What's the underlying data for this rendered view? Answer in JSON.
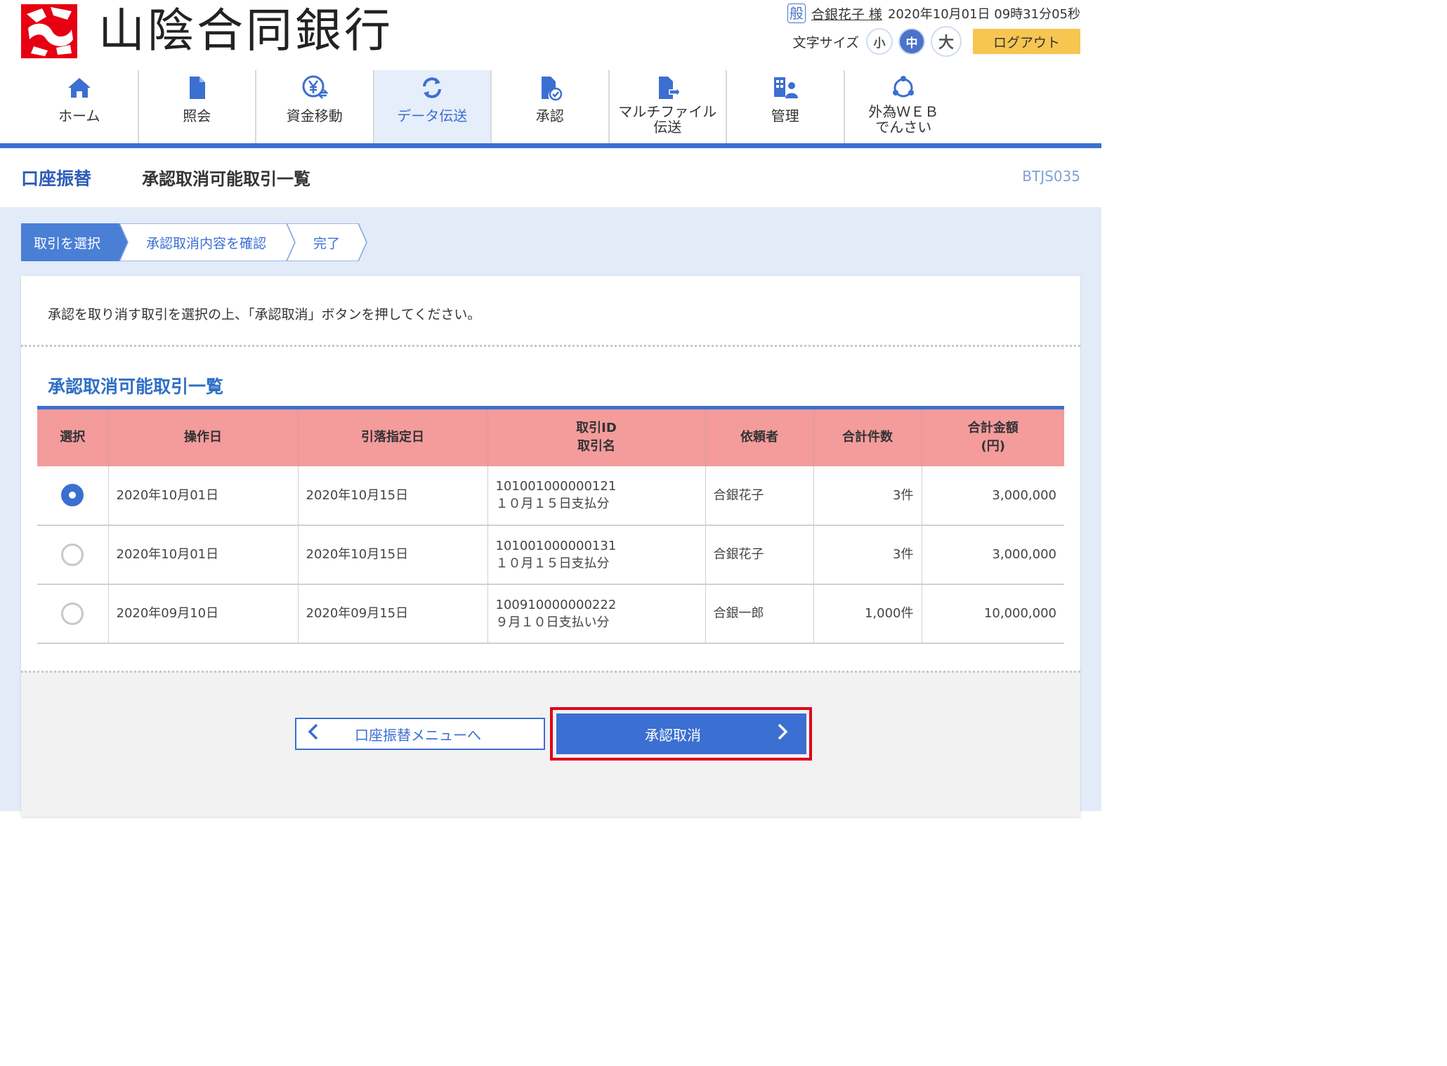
{
  "header": {
    "bank_name": "山陰合同銀行",
    "user_badge": "般",
    "user_name": "合銀花子 様",
    "datetime": "2020年10月01日 09時31分05秒",
    "fontsize_label": "文字サイズ",
    "fontsize_small": "小",
    "fontsize_medium": "中",
    "fontsize_large": "大",
    "logout_label": "ログアウト"
  },
  "nav": {
    "items": [
      {
        "label": "ホーム",
        "icon": "home-icon"
      },
      {
        "label": "照会",
        "icon": "document-icon"
      },
      {
        "label": "資金移動",
        "icon": "yen-transfer-icon"
      },
      {
        "label": "データ伝送",
        "icon": "sync-icon"
      },
      {
        "label": "承認",
        "icon": "approve-document-icon"
      },
      {
        "label": "マルチファイル\n伝送",
        "icon": "file-send-icon"
      },
      {
        "label": "管理",
        "icon": "admin-icon"
      },
      {
        "label": "外為ＷＥＢ\nでんさい",
        "icon": "circle-network-icon"
      }
    ],
    "active_index": 3
  },
  "title": {
    "category": "口座振替",
    "main": "承認取消可能取引一覧",
    "screen_code": "BTJS035"
  },
  "steps": [
    "取引を選択",
    "承認取消内容を確認",
    "完了"
  ],
  "instruction": "承認を取り消す取引を選択の上、「承認取消」ボタンを押してください。",
  "section_title": "承認取消可能取引一覧",
  "table": {
    "headers": {
      "select": "選択",
      "op_date": "操作日",
      "debit_date": "引落指定日",
      "txn_id": "取引ID",
      "txn_name": "取引名",
      "requester": "依頼者",
      "count": "合計件数",
      "amount": "合計金額",
      "amount_unit": "(円)"
    },
    "rows": [
      {
        "selected": true,
        "op_date": "2020年10月01日",
        "debit_date": "2020年10月15日",
        "txn_id": "101001000000121",
        "txn_name": "１０月１５日支払分",
        "requester": "合銀花子",
        "count": "3件",
        "amount": "3,000,000"
      },
      {
        "selected": false,
        "op_date": "2020年10月01日",
        "debit_date": "2020年10月15日",
        "txn_id": "101001000000131",
        "txn_name": "１０月１５日支払分",
        "requester": "合銀花子",
        "count": "3件",
        "amount": "3,000,000"
      },
      {
        "selected": false,
        "op_date": "2020年09月10日",
        "debit_date": "2020年09月15日",
        "txn_id": "100910000000222",
        "txn_name": "９月１０日支払い分",
        "requester": "合銀一郎",
        "count": "1,000件",
        "amount": "10,000,000"
      }
    ]
  },
  "buttons": {
    "back_label": "口座振替メニューへ",
    "submit_label": "承認取消"
  },
  "colors": {
    "brand_blue": "#3b6fd1",
    "header_pink": "#f49b9c",
    "logout_yellow": "#f7c651",
    "highlight_red": "#e0001b",
    "logo_red": "#e60012"
  }
}
